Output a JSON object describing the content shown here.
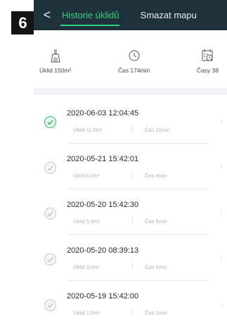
{
  "step": "6",
  "header": {
    "back_glyph": "<",
    "tab_history": "Historie úklidů",
    "tab_clear_map": "Smazat mapu"
  },
  "stats": [
    {
      "icon": "broom-icon",
      "label": "Úklid 150m²"
    },
    {
      "icon": "clock-icon",
      "label": "Čas 174min"
    },
    {
      "icon": "calendar-clock-icon",
      "label": "Časy 38"
    }
  ],
  "records": [
    {
      "datetime": "2020-06-03 12:04:45",
      "area": "Úklid  11.0m²",
      "time": "Čas  10min",
      "active": true
    },
    {
      "datetime": "2020-05-21 15:42:01",
      "area": "Úklid  6.0m²",
      "time": "Čas  4min",
      "active": false
    },
    {
      "datetime": "2020-05-20 15:42:30",
      "area": "Úklid  5.0m²",
      "time": "Čas  5min",
      "active": false
    },
    {
      "datetime": "2020-05-20 08:39:13",
      "area": "Úklid  3.0m²",
      "time": "Čas  5min",
      "active": false
    },
    {
      "datetime": "2020-05-19 15:42:00",
      "area": "Úklid  1.0m²",
      "time": "Čas  2min",
      "active": false
    }
  ],
  "colors": {
    "topbar": "#1f323c",
    "accent": "#2fd37a",
    "status_active": "#2fbf6a",
    "status_inactive": "#c9c9c9"
  }
}
